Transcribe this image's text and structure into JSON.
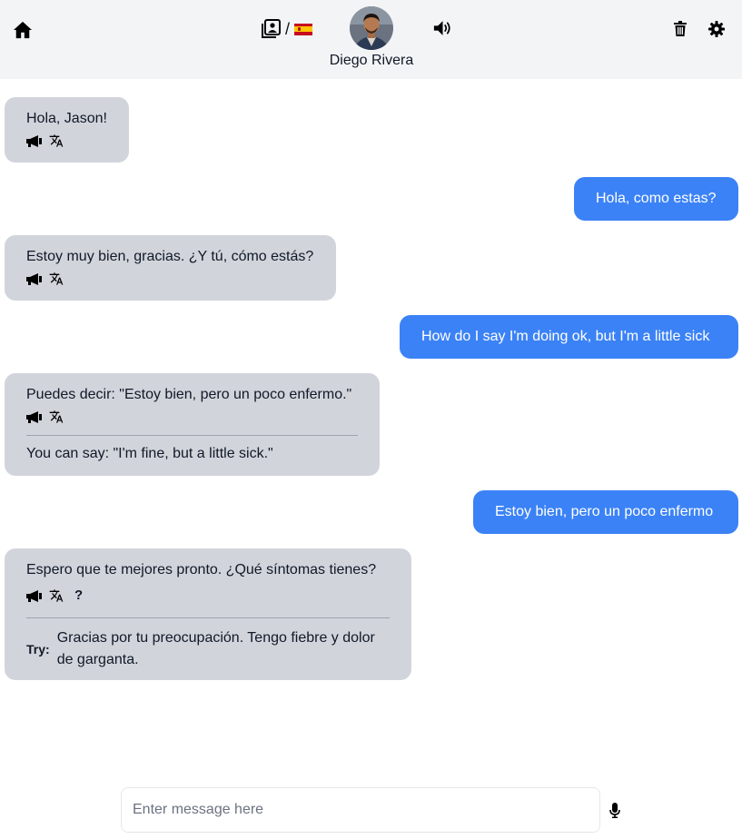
{
  "header": {
    "icons": {
      "home": "home-icon",
      "dictionary": "book-portrait-icon",
      "speaker": "speaker-icon",
      "trash": "trash-icon",
      "settings": "gear-icon"
    },
    "lang_separator": "/",
    "language_flag": "spain-flag",
    "contact_name": "Diego Rivera"
  },
  "messages": [
    {
      "role": "bot",
      "text": "Hola, Jason!"
    },
    {
      "role": "user",
      "text": "Hola, como estas?"
    },
    {
      "role": "bot",
      "text": "Estoy muy bien, gracias. ¿Y tú, cómo estás?"
    },
    {
      "role": "user",
      "text": "How do I say I'm doing ok, but I'm a little sick"
    },
    {
      "role": "bot",
      "text": "Puedes decir: \"Estoy bien, pero un poco enfermo.\"",
      "translation": "You can say: \"I'm fine, but a little sick.\""
    },
    {
      "role": "user",
      "text": "Estoy bien, pero un poco enfermo"
    },
    {
      "role": "bot",
      "text": "Espero que te mejores pronto. ¿Qué síntomas tienes?",
      "help_label": "?",
      "try_label": "Try:",
      "try_text": "Gracias por tu preocupación. Tengo fiebre y dolor de garganta."
    }
  ],
  "composer": {
    "placeholder": "Enter message here",
    "value": ""
  },
  "colors": {
    "header_bg": "#f3f4f6",
    "bot_bubble": "#d1d5db",
    "user_bubble": "#3b82f6",
    "user_text": "#ffffff"
  }
}
